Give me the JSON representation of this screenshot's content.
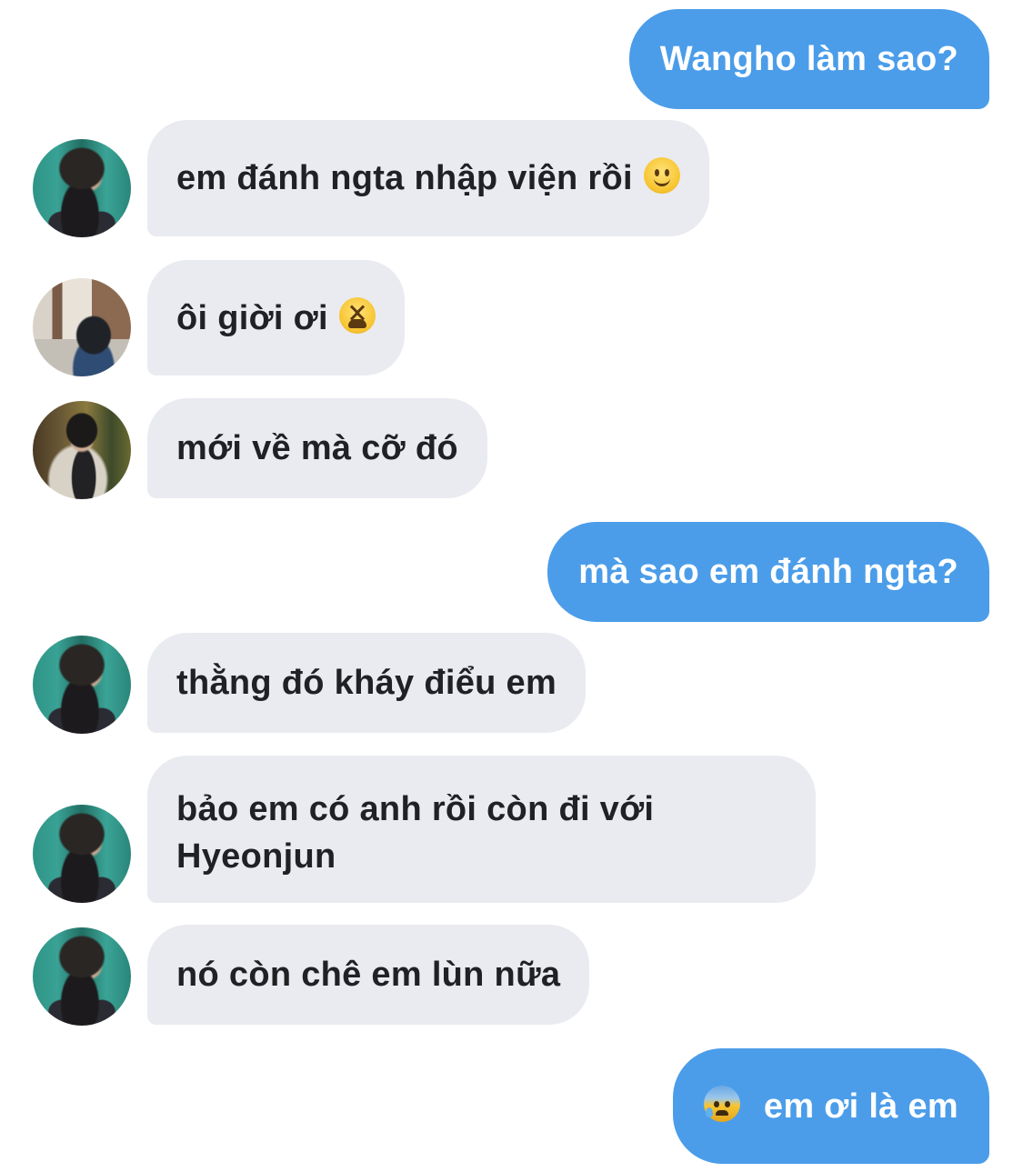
{
  "messages": [
    {
      "side": "out",
      "text": "Wangho làm sao?"
    },
    {
      "side": "in",
      "avatar": "avatar-dark-jacket",
      "text": "em đánh ngta nhập viện rồi",
      "emoji_after": "slightly-smiling-face-emoji"
    },
    {
      "side": "in",
      "avatar": "avatar-street",
      "text": "ôi giời ơi",
      "emoji_after": "tired-face-emoji"
    },
    {
      "side": "in",
      "avatar": "avatar-autumn",
      "text": "mới về mà cỡ đó"
    },
    {
      "side": "out",
      "text": "mà sao em đánh ngta?"
    },
    {
      "side": "in",
      "avatar": "avatar-dark-jacket",
      "text": "thằng đó kháy điểu em"
    },
    {
      "side": "in",
      "avatar": "avatar-dark-jacket",
      "text": "bảo em có anh rồi còn đi với\nHyeonjun"
    },
    {
      "side": "in",
      "avatar": "avatar-dark-jacket",
      "text": "nó còn chê em lùn nữa"
    },
    {
      "side": "out",
      "text": "em ơi là em",
      "emoji_before": "anxious-face-with-sweat-emoji"
    }
  ],
  "colors": {
    "outgoing_bubble": "#4b9de9",
    "incoming_bubble": "#e9ebf0",
    "incoming_text": "#1f2124",
    "outgoing_text": "#ffffff"
  }
}
